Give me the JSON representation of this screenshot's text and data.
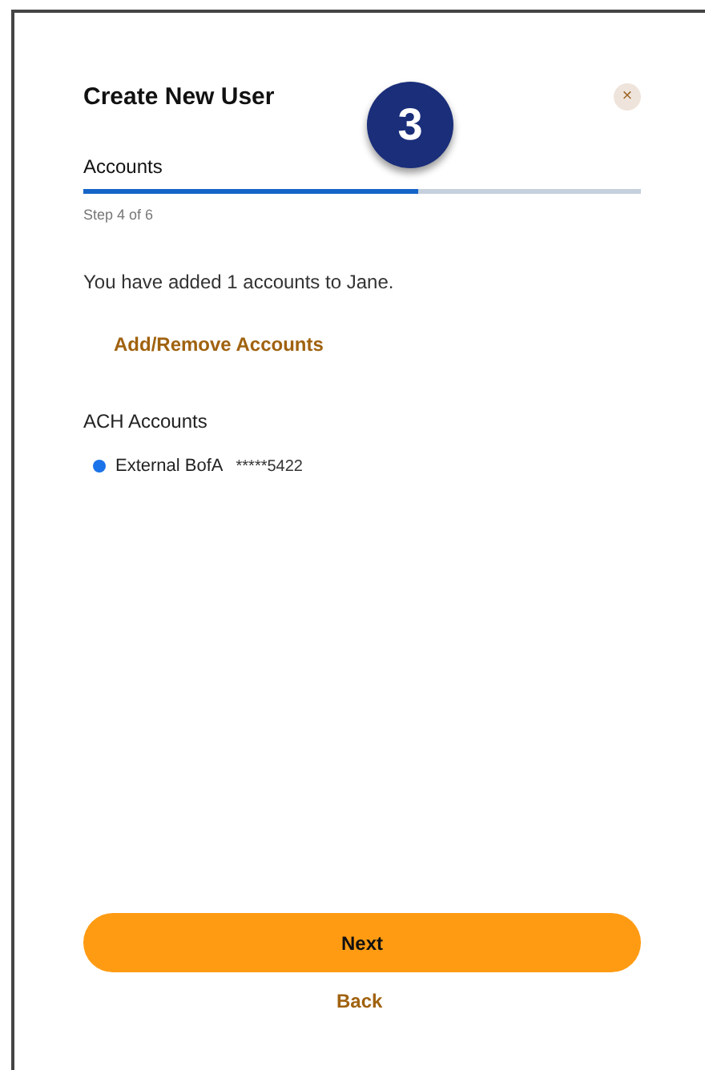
{
  "dialog": {
    "title": "Create New User",
    "close": "×"
  },
  "badge": {
    "text": "3"
  },
  "progress": {
    "label": "Accounts",
    "level": 0.6,
    "step": "Step 4 of 6"
  },
  "summary": "You have added 1 accounts to Jane.",
  "link": "Add/Remove Accounts",
  "section": {
    "title": "ACH Accounts",
    "accounts": [
      {
        "name": "External BofA",
        "number": "*****5422",
        "color": "#1a73e8"
      }
    ]
  },
  "buttons": {
    "next": "Next",
    "back": "Back"
  }
}
